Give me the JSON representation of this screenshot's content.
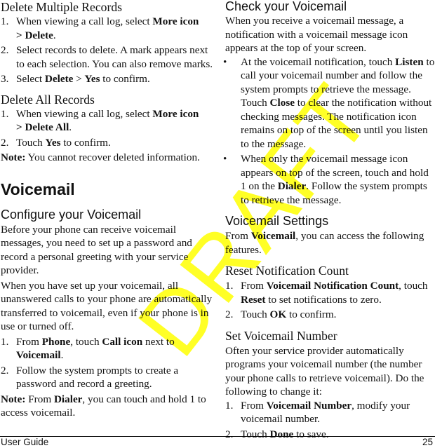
{
  "watermark": "DRAFT",
  "left": {
    "delete_multiple": {
      "title": "Delete Multiple Records",
      "steps": [
        {
          "num": "1.",
          "t1": "When viewing a call log, select ",
          "b1": "More icon",
          "t2": " ",
          "b2": "> Delete",
          "t3": "."
        },
        {
          "num": "2.",
          "text": "Select records to delete. A mark appears next to each selection. You can also remove marks."
        },
        {
          "num": "3.",
          "t1": "Select ",
          "b1": "Delete",
          "t2": " > ",
          "b2": "Yes",
          "t3": " to confirm."
        }
      ]
    },
    "delete_all": {
      "title": "Delete All Records",
      "steps": [
        {
          "num": "1.",
          "t1": "When viewing a call log, select ",
          "b1": "More icon",
          "t2": " ",
          "b2": "> Delete All",
          "t3": "."
        },
        {
          "num": "2.",
          "t1": "Touch ",
          "b1": "Yes",
          "t2": " to confirm."
        }
      ],
      "note_label": "Note:",
      "note_text": " You cannot recover deleted information."
    },
    "voicemail_title": "Voicemail",
    "configure": {
      "title": "Configure your Voicemail",
      "para1": "Before your phone can receive voicemail messages, you need to set up a password and record a personal greeting with your service provider.",
      "para2": "When you have set up your voicemail, all unanswered calls to your phone are automatically transferred to voicemail, even if your phone is in use or turned off.",
      "steps": [
        {
          "num": "1.",
          "t1": "From ",
          "b1": "Phone",
          "t2": ", touch ",
          "b2": "Call icon",
          "t3": " next to ",
          "b3": "Voicemail",
          "t4": "."
        },
        {
          "num": "2.",
          "text": "Follow the system prompts to create a password and record a greeting."
        }
      ],
      "note_label": "Note:",
      "note_t1": " From ",
      "note_b1": "Dialer",
      "note_t2": ", you can touch and hold 1 to access voicemail."
    }
  },
  "right": {
    "check": {
      "title": "Check your Voicemail",
      "para": "When you receive a voicemail message, a notification with a voicemail message icon appears at the top of your screen.",
      "bullets": [
        {
          "t1": "At the voicemail notification, touch ",
          "b1": "Listen",
          "t2": " to call your voicemail number and follow the system prompts to retrieve the message. Touch ",
          "b2": "Close",
          "t3": " to clear the notification without checking messages. The notification icon remains on top of the screen until you listen to the message."
        },
        {
          "t1": "When only the voicemail message icon appears on top of the screen, touch and hold 1 on the ",
          "b1": "Dialer",
          "t2": ". Follow the system prompts to retrieve the message."
        }
      ]
    },
    "settings": {
      "title": "Voicemail Settings",
      "t1": "From ",
      "b1": "Voicemail",
      "t2": ", you can access the following features."
    },
    "reset": {
      "title": "Reset Notification Count",
      "steps": [
        {
          "num": "1.",
          "t1": "From ",
          "b1": "Voicemail Notification Count",
          "t2": ", touch ",
          "b2": "Reset",
          "t3": " to set notifications to zero."
        },
        {
          "num": "2.",
          "t1": "Touch ",
          "b1": "OK",
          "t2": " to confirm."
        }
      ]
    },
    "setnum": {
      "title": "Set Voicemail Number",
      "para": "Often your service provider automatically programs your voicemail number (the number your phone calls to retrieve voicemail). Do the following to change it:",
      "steps": [
        {
          "num": "1.",
          "t1": "From ",
          "b1": "Voicemail Number",
          "t2": ", modify your voicemail number."
        },
        {
          "num": "2.",
          "t1": "Touch ",
          "b1": "Done",
          "t2": " to save."
        }
      ]
    }
  },
  "footer": {
    "left": "User Guide",
    "page": "25"
  }
}
